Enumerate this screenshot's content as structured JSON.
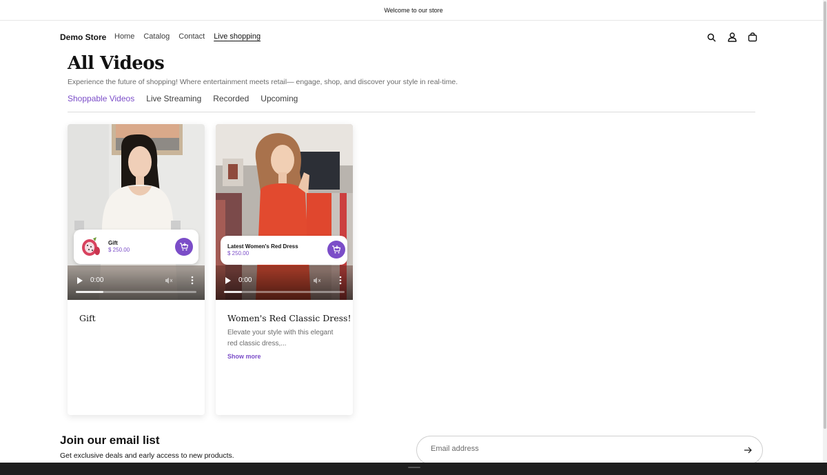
{
  "announcement": {
    "text": "Welcome to our store"
  },
  "header": {
    "logo": "Demo Store",
    "nav": [
      "Home",
      "Catalog",
      "Contact",
      "Live shopping"
    ],
    "icons": [
      "search-icon",
      "account-icon",
      "cart-bag-icon"
    ]
  },
  "page": {
    "title": "All Videos",
    "subtitle": "Experience the future of shopping! Where entertainment meets retail— engage, shop, and discover your style in real-time."
  },
  "tabs": [
    {
      "label": "Shoppable Videos",
      "active": true
    },
    {
      "label": "Live Streaming",
      "active": false
    },
    {
      "label": "Recorded",
      "active": false
    },
    {
      "label": "Upcoming",
      "active": false
    }
  ],
  "videos": [
    {
      "product_name": "Gift",
      "product_price": "$ 250.00",
      "time": "0:00",
      "progress": 0.23,
      "title": "Gift",
      "description": "",
      "show_more": ""
    },
    {
      "product_name": "Latest Women's Red Dress",
      "product_price": "$ 250.00",
      "time": "0:00",
      "progress": 0.15,
      "title": "Women's Red Classic Dress!",
      "description": "Elevate your style with this elegant red classic dress,...",
      "show_more": "Show more"
    }
  ],
  "newsletter": {
    "title": "Join our email list",
    "subtitle": "Get exclusive deals and early access to new products.",
    "placeholder": "Email address"
  },
  "colors": {
    "accent": "#7b4dc8",
    "text": "#121212",
    "muted": "#6b6b6b"
  }
}
